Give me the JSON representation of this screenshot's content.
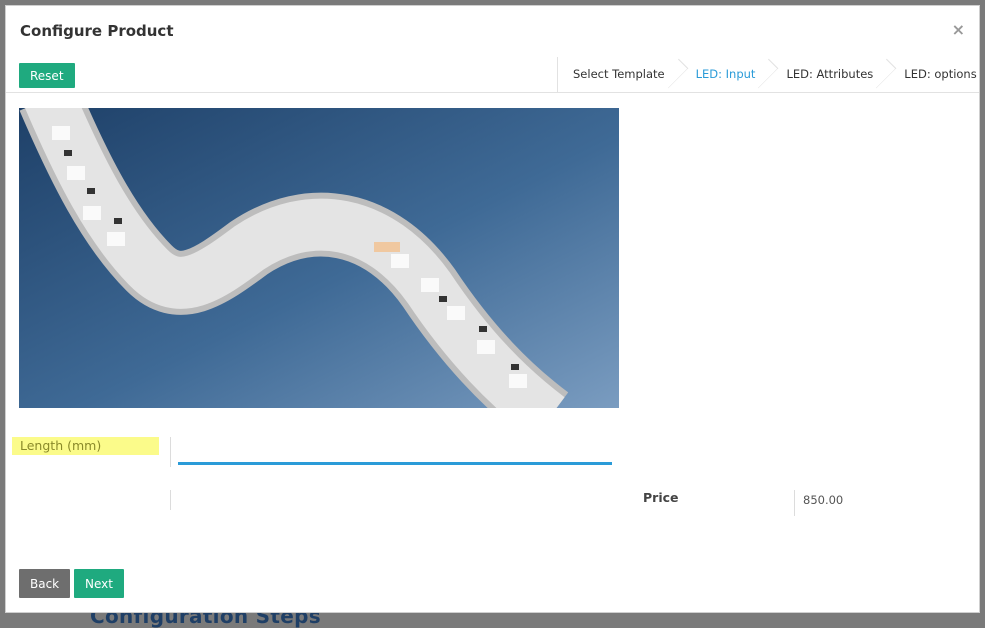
{
  "backdrop": {
    "heading": "Configuration Steps"
  },
  "modal": {
    "title": "Configure Product",
    "close_glyph": "×"
  },
  "toolbar": {
    "reset_label": "Reset"
  },
  "steps": [
    {
      "label": "Select Template",
      "active": false
    },
    {
      "label": "LED: Input",
      "active": true
    },
    {
      "label": "LED: Attributes",
      "active": false
    },
    {
      "label": "LED: options",
      "active": false
    }
  ],
  "form": {
    "length_label": "Length (mm)",
    "length_value": "",
    "price_label": "Price",
    "price_value": "850.00"
  },
  "footer": {
    "back_label": "Back",
    "next_label": "Next"
  },
  "colors": {
    "accent_green": "#1faa7f",
    "active_step": "#2a9bd8",
    "highlight": "#fbfb8a"
  }
}
